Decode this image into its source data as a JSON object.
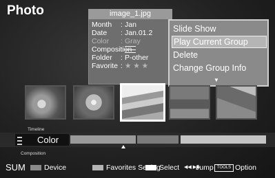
{
  "screen": {
    "title": "Photo"
  },
  "info_panel": {
    "filename": "image_1.jpg",
    "rows": [
      {
        "key": "Month",
        "value": "Jan"
      },
      {
        "key": "Date",
        "value": "Jan.01.2"
      },
      {
        "key": "Color",
        "value": "Gray"
      },
      {
        "key": "Composition",
        "value": ""
      },
      {
        "key": "Folder",
        "value": "P-other"
      },
      {
        "key": "Favorite",
        "value": "★ ★ ★"
      }
    ]
  },
  "menu": {
    "items": [
      {
        "label": "Slide Show",
        "selected": false
      },
      {
        "label": "Play Current Group",
        "selected": true
      },
      {
        "label": "Delete",
        "selected": false
      },
      {
        "label": "Change Group Info",
        "selected": false
      }
    ],
    "more_icon": "arrow-down-icon"
  },
  "thumbnails": [
    {
      "name": "dandelion-thumbnail",
      "selected": false
    },
    {
      "name": "flower-thumbnail",
      "selected": false
    },
    {
      "name": "landscape-thumbnail",
      "selected": true
    },
    {
      "name": "scene-thumbnail",
      "selected": false
    },
    {
      "name": "sky-thumbnail",
      "selected": false
    }
  ],
  "timeline": {
    "timeline_label": "Timeline",
    "current": "Color",
    "composition_label": "Composition"
  },
  "help_bar": {
    "sum": "SUM",
    "device": "Device",
    "favorites": "Favorites Setting",
    "select": "Select",
    "jump_glyph": "◀◀ ▶▶",
    "jump": "Jump",
    "tools": "TOOLS",
    "option": "Option"
  }
}
